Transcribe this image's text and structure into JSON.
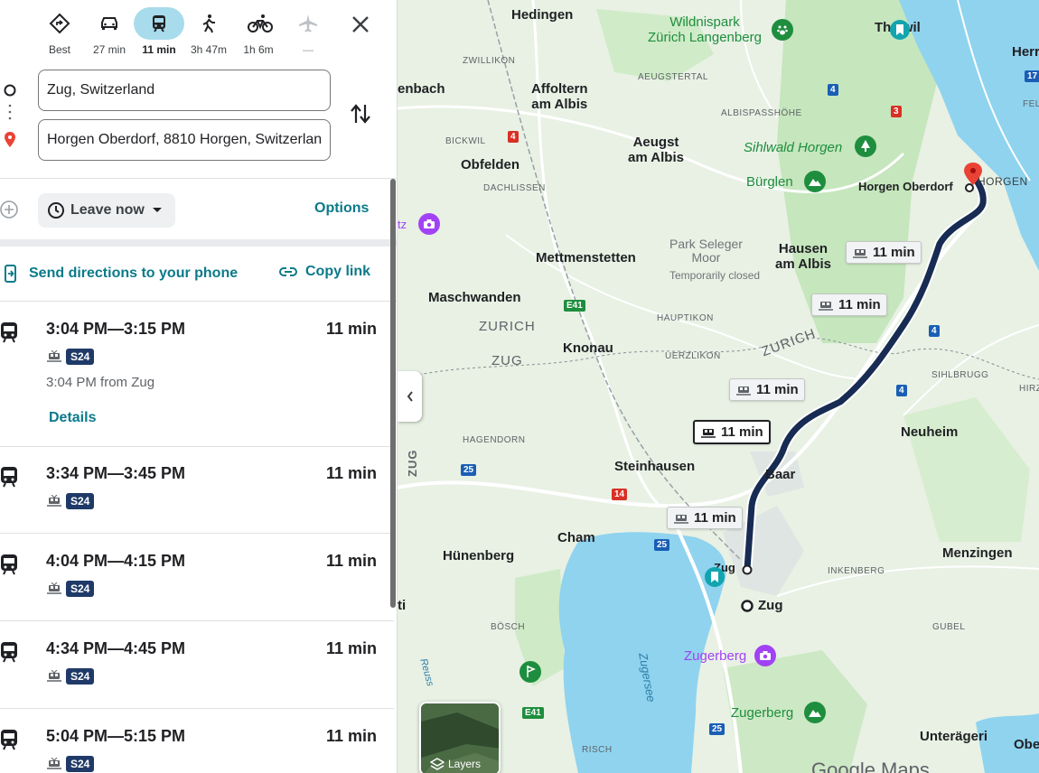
{
  "travel_modes": [
    {
      "icon": "directions-diamond-icon",
      "label": "Best"
    },
    {
      "icon": "car-icon",
      "label": "27 min"
    },
    {
      "icon": "transit-icon",
      "label": "11 min",
      "active": true
    },
    {
      "icon": "walk-icon",
      "label": "3h 47m"
    },
    {
      "icon": "bicycle-icon",
      "label": "1h 6m"
    },
    {
      "icon": "flight-icon",
      "label": "—",
      "disabled": true
    }
  ],
  "origin": {
    "value": "Zug, Switzerland"
  },
  "destination": {
    "value": "Horgen Oberdorf, 8810 Horgen, Switzerland"
  },
  "leave_now": "Leave now",
  "options": "Options",
  "send_directions": "Send directions to your phone",
  "copy_link": "Copy link",
  "routes": [
    {
      "time": "3:04 PM—3:15 PM",
      "duration": "11 min",
      "line": "S24",
      "from": "3:04 PM from Zug",
      "details": "Details"
    },
    {
      "time": "3:34 PM—3:45 PM",
      "duration": "11 min",
      "line": "S24"
    },
    {
      "time": "4:04 PM—4:15 PM",
      "duration": "11 min",
      "line": "S24"
    },
    {
      "time": "4:34 PM—4:45 PM",
      "duration": "11 min",
      "line": "S24"
    },
    {
      "time": "5:04 PM—5:15 PM",
      "duration": "11 min",
      "line": "S24"
    }
  ],
  "map": {
    "towns": {
      "hedingen": "Hedingen",
      "affoltern": "Affoltern\nam Albis",
      "aeugst": "Aeugst\nam Albis",
      "obfelden": "Obfelden",
      "mettmenstetten": "Mettmenstetten",
      "maschwanden": "Maschwanden",
      "knonau": "Knonau",
      "hausen": "Hausen\nam Albis",
      "horgen_oberdorf": "Horgen Oberdorf",
      "horgen": "HORGEN",
      "neuheim": "Neuheim",
      "steinhausen": "Steinhausen",
      "baar": "Baar",
      "cham": "Cham",
      "huenenberg": "Hünenberg",
      "zug_station": "Zug",
      "zug_origin": "Zug",
      "menzingen": "Menzingen",
      "unteraegeri": "Unterägeri",
      "thalwil": "Thalwil",
      "ennbach": "enbach"
    },
    "small_labels": {
      "zwillikon": "ZWILLIKON",
      "aeugstertal": "AEUGSTERTAL",
      "albispasshoehe": "ALBISPASSHÖHE",
      "bickwil": "BICKWIL",
      "dachlissen": "DACHLISSEN",
      "hauptikon": "HAUPTIKON",
      "uerzlikon": "UERZLIKON",
      "sihlbrugg": "SIHLBRUGG",
      "hagendorn": "HAGENDORN",
      "inkenberg": "INKENBERG",
      "boesch": "BÖSCH",
      "gubel": "GUBEL",
      "risch": "RISCH",
      "felt": "FEL",
      "hirz": "HIRZ"
    },
    "cantons": {
      "zurich1": "ZURICH",
      "zug1": "ZUG",
      "zurich2": "ZURICH",
      "zug2": "ZUG"
    },
    "parks": {
      "wildnispark": "Wildnispark\nZürich Langenberg",
      "sihlwald": "Sihlwald Horgen",
      "buerglen": "Bürglen",
      "zugerberg_park": "Zugerberg"
    },
    "pois": {
      "zugerberg": "Zugerberg",
      "park_seleger": "Park Seleger\nMoor",
      "temporarily_closed": "Temporarily closed",
      "tz": "tz"
    },
    "water": {
      "zugersee": "Zugersee",
      "reuss": "Reuss"
    },
    "edge_labels": {
      "herr": "Herr",
      "obe": "Obe",
      "ti": "ti"
    },
    "roads": {
      "r4a": "4",
      "r3": "3",
      "r4b": "4",
      "r4c": "4",
      "e41a": "E41",
      "r25a": "25",
      "r14": "14",
      "r25b": "25",
      "e41b": "E41",
      "r25c": "25",
      "r17": "17",
      "r4d": "4"
    },
    "time_tags": [
      "11 min",
      "11 min",
      "11 min",
      "11 min",
      "11 min"
    ],
    "layers": "Layers",
    "google": "Google Maps"
  },
  "colors": {
    "accent": "#0b7a89",
    "route": "#172b53",
    "badge": "#1f3a68",
    "water": "#8fd3ef",
    "active_mode": "#a8dcec"
  }
}
